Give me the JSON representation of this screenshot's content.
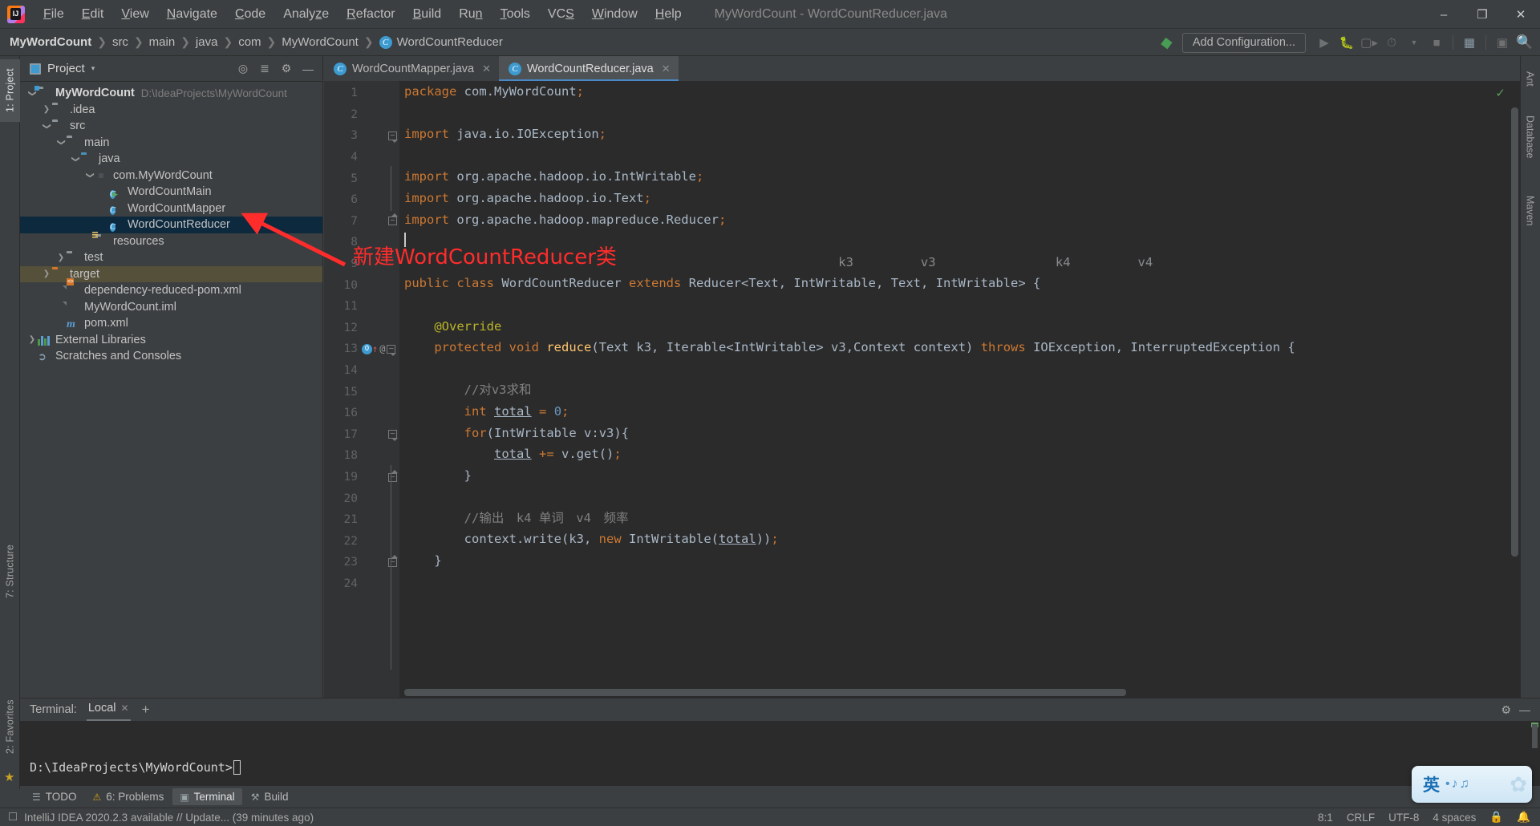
{
  "window": {
    "title": "MyWordCount - WordCountReducer.java",
    "menus": [
      {
        "label": "File",
        "accel": "F"
      },
      {
        "label": "Edit",
        "accel": "E"
      },
      {
        "label": "View",
        "accel": "V"
      },
      {
        "label": "Navigate",
        "accel": "N"
      },
      {
        "label": "Code",
        "accel": "C"
      },
      {
        "label": "Analyze",
        "accel": "z"
      },
      {
        "label": "Refactor",
        "accel": "R"
      },
      {
        "label": "Build",
        "accel": "B"
      },
      {
        "label": "Run",
        "accel": "n"
      },
      {
        "label": "Tools",
        "accel": "T"
      },
      {
        "label": "VCS",
        "accel": "S"
      },
      {
        "label": "Window",
        "accel": "W"
      },
      {
        "label": "Help",
        "accel": "H"
      }
    ],
    "controls": {
      "minimize": "–",
      "maximize": "❐",
      "close": "✕"
    }
  },
  "navbar": {
    "breadcrumb": [
      "MyWordCount",
      "src",
      "main",
      "java",
      "com",
      "MyWordCount",
      "WordCountReducer"
    ],
    "separator": "❯",
    "class_icon_letter": "C",
    "add_configuration": "Add Configuration...",
    "icons": [
      "hammer-icon",
      "run-icon",
      "debug-icon",
      "run-coverage-icon",
      "profile-icon",
      "dropdown-icon",
      "stop-icon",
      "project-structure-icon",
      "update-icon",
      "search-icon"
    ]
  },
  "left_strips": [
    {
      "label": "1: Project",
      "selected": true
    },
    {
      "label": "7: Structure",
      "selected": false
    },
    {
      "label": "2: Favorites",
      "selected": false
    }
  ],
  "right_strips": [
    {
      "label": "Ant"
    },
    {
      "label": "Database"
    },
    {
      "label": "Maven"
    }
  ],
  "project_panel": {
    "title": "Project",
    "caret": "▾",
    "header_icons": [
      "locate-icon",
      "collapse-all-icon",
      "settings-gear-icon",
      "hide-icon"
    ],
    "tree": [
      {
        "depth": 0,
        "arrow": "down",
        "icon": "project-folder",
        "label": "MyWordCount",
        "bold": true,
        "path": "D:\\IdeaProjects\\MyWordCount",
        "state": "normal"
      },
      {
        "depth": 1,
        "arrow": "right",
        "icon": "folder",
        "label": ".idea",
        "state": "normal"
      },
      {
        "depth": 1,
        "arrow": "down",
        "icon": "folder",
        "label": "src",
        "state": "normal"
      },
      {
        "depth": 2,
        "arrow": "down",
        "icon": "folder",
        "label": "main",
        "state": "normal"
      },
      {
        "depth": 3,
        "arrow": "down",
        "icon": "source-folder",
        "label": "java",
        "state": "normal"
      },
      {
        "depth": 4,
        "arrow": "down",
        "icon": "package",
        "label": "com.MyWordCount",
        "state": "normal"
      },
      {
        "depth": 5,
        "arrow": "none",
        "icon": "class-runnable",
        "label": "WordCountMain",
        "state": "normal"
      },
      {
        "depth": 5,
        "arrow": "none",
        "icon": "class",
        "label": "WordCountMapper",
        "state": "normal"
      },
      {
        "depth": 5,
        "arrow": "none",
        "icon": "class",
        "label": "WordCountReducer",
        "state": "selected"
      },
      {
        "depth": 4,
        "arrow": "none",
        "icon": "resource-folder",
        "label": "resources",
        "state": "normal"
      },
      {
        "depth": 2,
        "arrow": "right",
        "icon": "folder",
        "label": "test",
        "state": "normal"
      },
      {
        "depth": 1,
        "arrow": "right",
        "icon": "target-folder",
        "label": "target",
        "state": "target"
      },
      {
        "depth": 2,
        "arrow": "none",
        "icon": "xml-file",
        "label": "dependency-reduced-pom.xml",
        "state": "normal"
      },
      {
        "depth": 2,
        "arrow": "none",
        "icon": "iml-file",
        "label": "MyWordCount.iml",
        "state": "normal"
      },
      {
        "depth": 2,
        "arrow": "none",
        "icon": "maven-file",
        "label": "pom.xml",
        "state": "normal"
      },
      {
        "depth": 0,
        "arrow": "right",
        "icon": "libraries",
        "label": "External Libraries",
        "state": "normal"
      },
      {
        "depth": 0,
        "arrow": "none",
        "icon": "scratches",
        "label": "Scratches and Consoles",
        "state": "normal"
      }
    ]
  },
  "editor": {
    "tabs": [
      {
        "label": "WordCountMapper.java",
        "active": false,
        "close": "✕",
        "icon_letter": "C"
      },
      {
        "label": "WordCountReducer.java",
        "active": true,
        "close": "✕",
        "icon_letter": "C"
      }
    ],
    "inspection_status": "✓",
    "inlay_hints": [
      "k3",
      "v3",
      "k4",
      "v4"
    ],
    "lines": [
      {
        "n": 1,
        "text": "package com.MyWordCount;"
      },
      {
        "n": 2,
        "text": ""
      },
      {
        "n": 3,
        "text": "import java.io.IOException;"
      },
      {
        "n": 4,
        "text": ""
      },
      {
        "n": 5,
        "text": "import org.apache.hadoop.io.IntWritable;"
      },
      {
        "n": 6,
        "text": "import org.apache.hadoop.io.Text;"
      },
      {
        "n": 7,
        "text": "import org.apache.hadoop.mapreduce.Reducer;"
      },
      {
        "n": 8,
        "text": ""
      },
      {
        "n": 9,
        "text": ""
      },
      {
        "n": 10,
        "text": "public class WordCountReducer extends Reducer<Text, IntWritable, Text, IntWritable> {"
      },
      {
        "n": 11,
        "text": ""
      },
      {
        "n": 12,
        "text": "    @Override"
      },
      {
        "n": 13,
        "text": "    protected void reduce(Text k3, Iterable<IntWritable> v3,Context context) throws IOException, InterruptedException {"
      },
      {
        "n": 14,
        "text": ""
      },
      {
        "n": 15,
        "text": "        //对v3求和"
      },
      {
        "n": 16,
        "text": "        int total = 0;"
      },
      {
        "n": 17,
        "text": "        for(IntWritable v:v3){"
      },
      {
        "n": 18,
        "text": "            total += v.get();"
      },
      {
        "n": 19,
        "text": "        }"
      },
      {
        "n": 20,
        "text": ""
      },
      {
        "n": 21,
        "text": "        //输出　k4 单词　v4　频率"
      },
      {
        "n": 22,
        "text": "        context.write(k3, new IntWritable(total));"
      },
      {
        "n": 23,
        "text": "    }"
      },
      {
        "n": 24,
        "text": ""
      }
    ]
  },
  "annotation": {
    "text": "新建WordCountReducer类",
    "color": "#ff2c2c"
  },
  "terminal": {
    "label": "Terminal:",
    "tab": "Local",
    "tab_close": "✕",
    "add": "+",
    "settings_icon": "gear-icon",
    "hide_icon": "hide-icon",
    "prompt": "D:\\IdeaProjects\\MyWordCount>"
  },
  "tool_buttons": [
    {
      "label": "TODO",
      "icon": "todo-icon",
      "active": false
    },
    {
      "label": "6: Problems",
      "icon": "problems-icon",
      "active": false
    },
    {
      "label": "Terminal",
      "icon": "terminal-icon",
      "active": true
    },
    {
      "label": "Build",
      "icon": "build-hammer-icon",
      "active": false
    }
  ],
  "statusbar": {
    "message": "IntelliJ IDEA 2020.2.3 available // Update... (39 minutes ago)",
    "caret_position": "8:1",
    "line_separator": "CRLF",
    "encoding": "UTF-8",
    "indent": "4 spaces",
    "lock_icon": "lock-icon",
    "notification_icon": "notification-icon"
  },
  "ime": {
    "mode": "英",
    "dots": "•♪♫"
  }
}
